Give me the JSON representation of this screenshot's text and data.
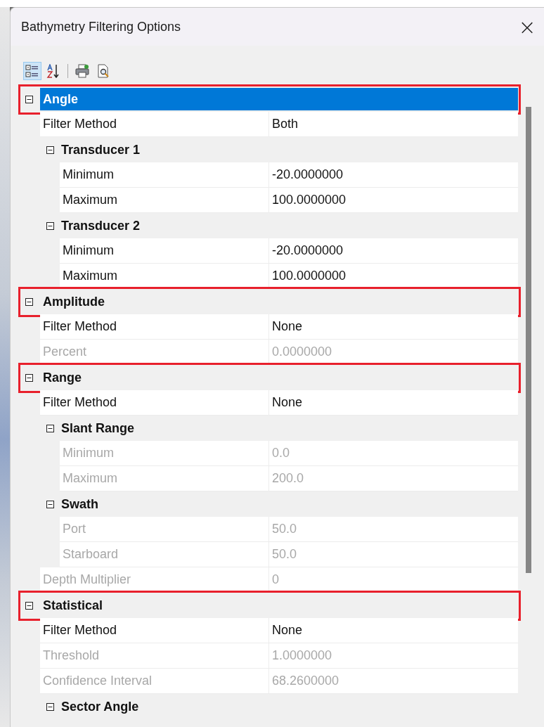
{
  "window": {
    "title": "Bathymetry Filtering Options",
    "close": "×"
  },
  "view_buttons": [
    {
      "kind": "categorized",
      "selected": true
    },
    {
      "kind": "alphabetical",
      "selected": false
    }
  ],
  "tool_buttons": [
    {
      "kind": "print"
    },
    {
      "kind": "preview"
    }
  ],
  "categories": [
    {
      "label": "Angle",
      "expanded": true,
      "selected": true,
      "annotated": true,
      "items": [
        {
          "kind": "property",
          "label": "Filter Method",
          "value": "Both",
          "disabled": false
        },
        {
          "kind": "group",
          "label": "Transducer 1",
          "expanded": true,
          "children": [
            {
              "kind": "property",
              "label": "Minimum",
              "value": "-20.0000000",
              "disabled": false
            },
            {
              "kind": "property",
              "label": "Maximum",
              "value": "100.0000000",
              "disabled": false
            }
          ]
        },
        {
          "kind": "group",
          "label": "Transducer 2",
          "expanded": true,
          "children": [
            {
              "kind": "property",
              "label": "Minimum",
              "value": "-20.0000000",
              "disabled": false
            },
            {
              "kind": "property",
              "label": "Maximum",
              "value": "100.0000000",
              "disabled": false
            }
          ]
        }
      ]
    },
    {
      "label": "Amplitude",
      "expanded": true,
      "selected": false,
      "annotated": true,
      "items": [
        {
          "kind": "property",
          "label": "Filter Method",
          "value": "None",
          "disabled": false
        },
        {
          "kind": "property",
          "label": "Percent",
          "value": "0.0000000",
          "disabled": true
        }
      ]
    },
    {
      "label": "Range",
      "expanded": true,
      "selected": false,
      "annotated": true,
      "items": [
        {
          "kind": "property",
          "label": "Filter Method",
          "value": "None",
          "disabled": false
        },
        {
          "kind": "group",
          "label": "Slant Range",
          "expanded": true,
          "children": [
            {
              "kind": "property",
              "label": "Minimum",
              "value": "0.0",
              "disabled": true
            },
            {
              "kind": "property",
              "label": "Maximum",
              "value": "200.0",
              "disabled": true
            }
          ]
        },
        {
          "kind": "group",
          "label": "Swath",
          "expanded": true,
          "children": [
            {
              "kind": "property",
              "label": "Port",
              "value": "50.0",
              "disabled": true
            },
            {
              "kind": "property",
              "label": "Starboard",
              "value": "50.0",
              "disabled": true
            }
          ]
        },
        {
          "kind": "property",
          "label": "Depth Multiplier",
          "value": "0",
          "disabled": true
        }
      ]
    },
    {
      "label": "Statistical",
      "expanded": true,
      "selected": false,
      "annotated": true,
      "items": [
        {
          "kind": "property",
          "label": "Filter Method",
          "value": "None",
          "disabled": false
        },
        {
          "kind": "property",
          "label": "Threshold",
          "value": "1.0000000",
          "disabled": true
        },
        {
          "kind": "property",
          "label": "Confidence Interval",
          "value": "68.2600000",
          "disabled": true
        },
        {
          "kind": "group",
          "label": "Sector Angle",
          "expanded": true
        }
      ]
    }
  ]
}
